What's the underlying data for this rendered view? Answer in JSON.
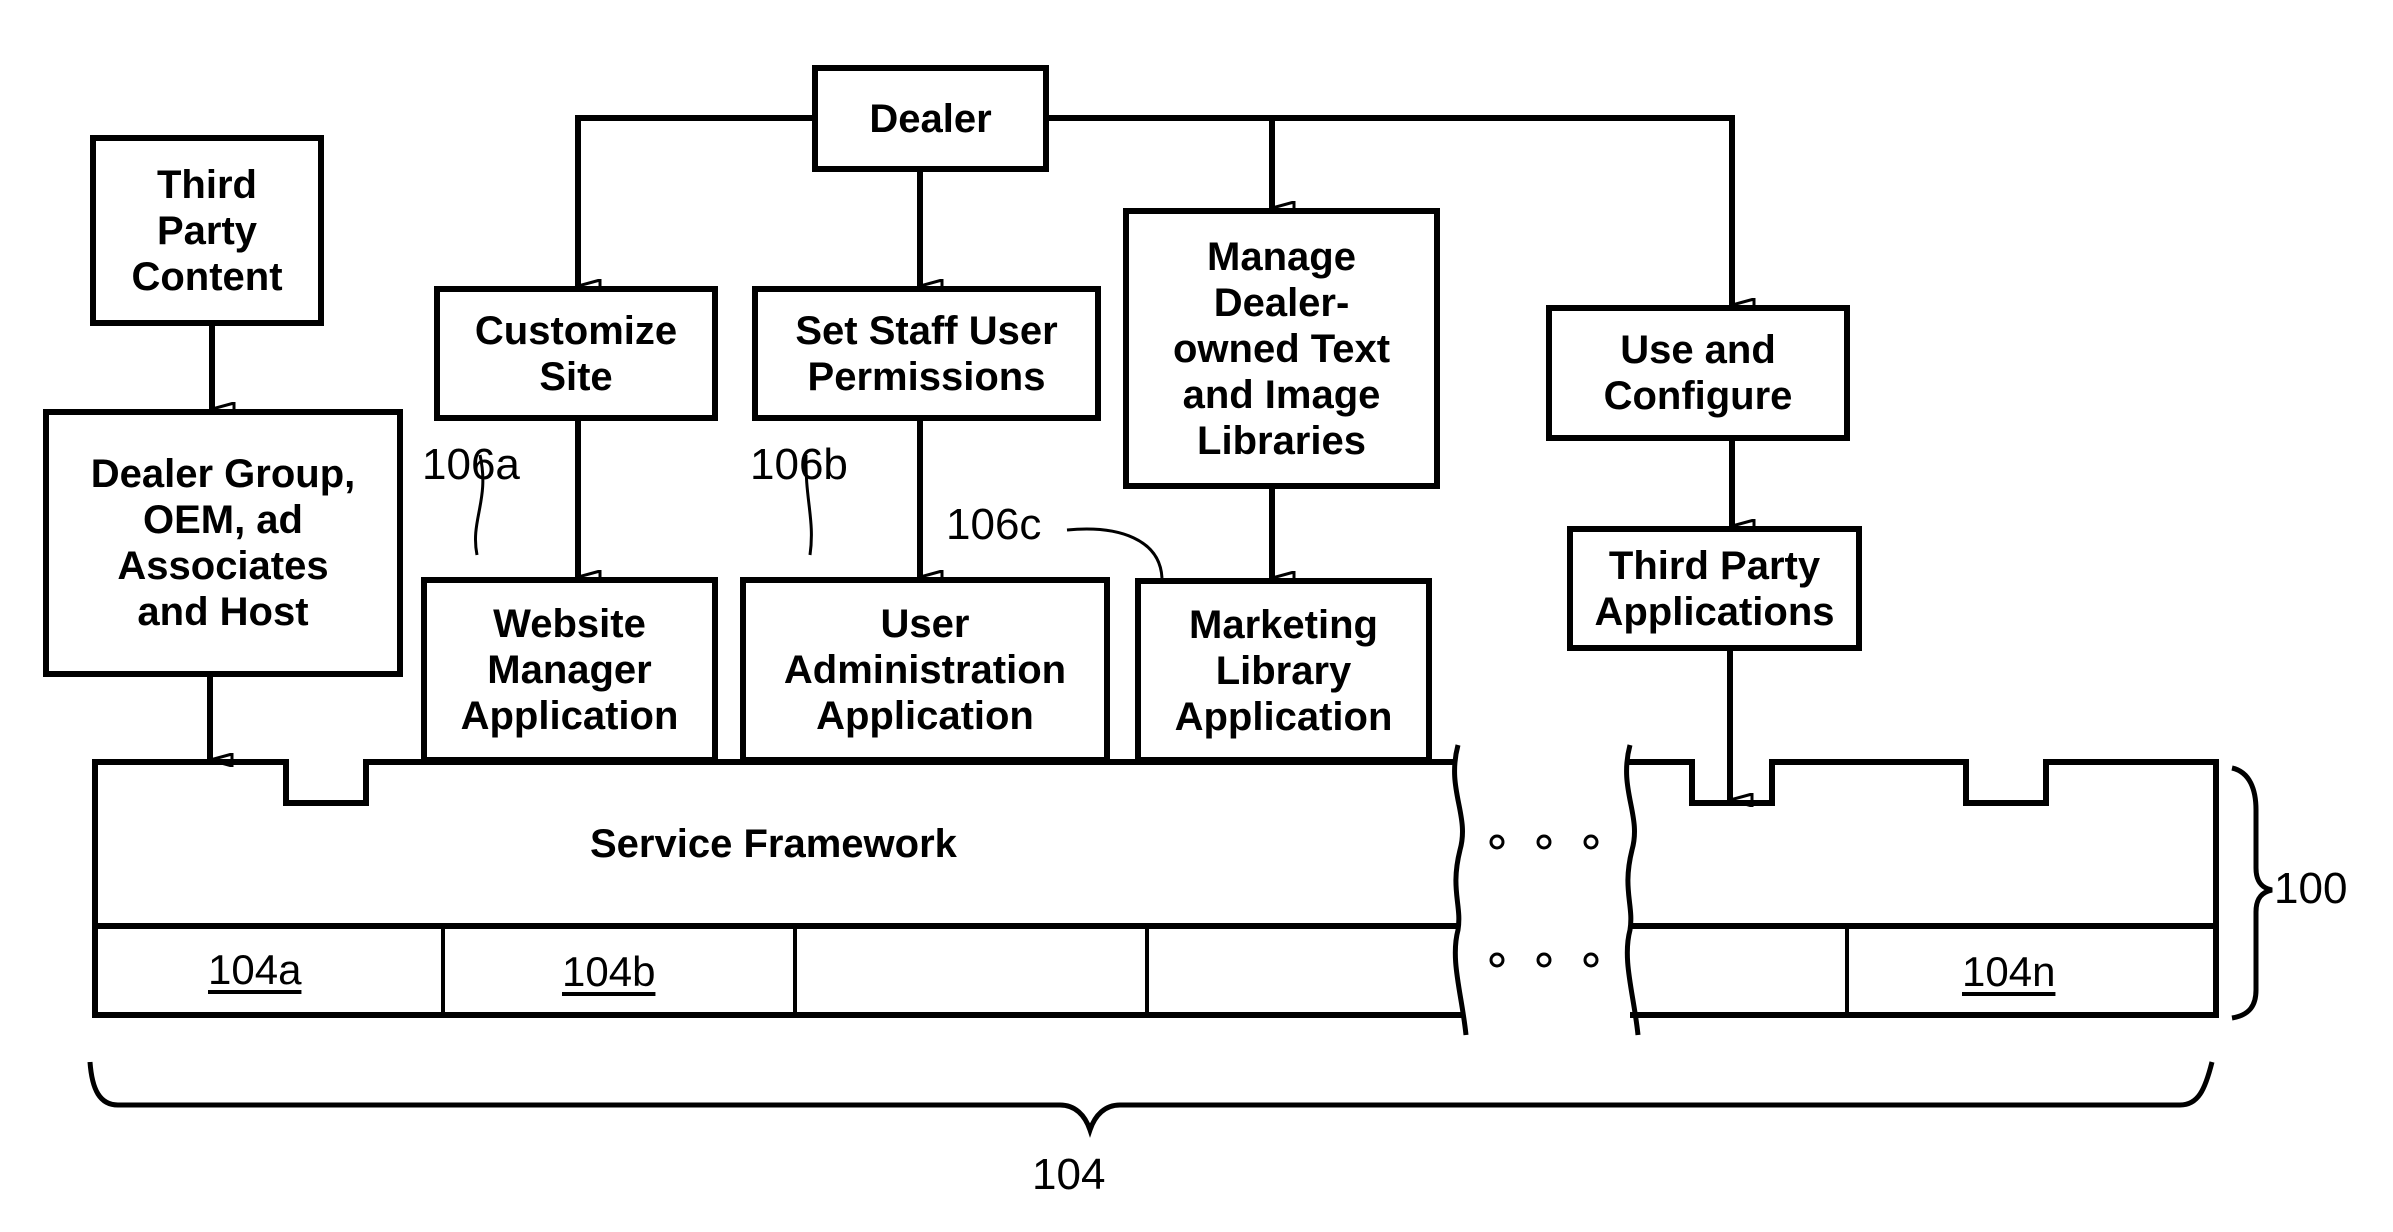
{
  "boxes": {
    "dealer": "Dealer",
    "third_party_content": "Third\nParty\nContent",
    "customize_site": "Customize\nSite",
    "set_staff": "Set Staff User\nPermissions",
    "manage_libraries": "Manage\nDealer-\nowned Text\nand Image\nLibraries",
    "use_configure": "Use and\nConfigure",
    "dealer_group": "Dealer Group,\nOEM, ad\nAssociates\nand Host",
    "website_manager": "Website\nManager\nApplication",
    "user_admin": "User\nAdministration\nApplication",
    "marketing_library": "Marketing\nLibrary\nApplication",
    "third_party_apps": "Third Party\nApplications"
  },
  "framework": {
    "label": "Service Framework",
    "cells": [
      "104a",
      "104b",
      "",
      "",
      "",
      "104n"
    ]
  },
  "refs": {
    "r106a": "106a",
    "r106b": "106b",
    "r106c": "106c",
    "r104": "104",
    "r100": "100"
  }
}
